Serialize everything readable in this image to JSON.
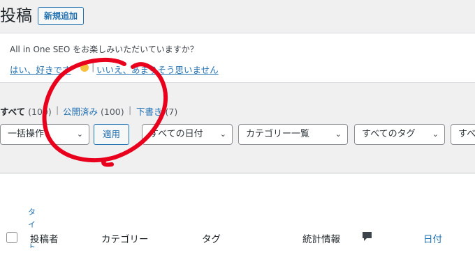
{
  "header": {
    "title": "投稿",
    "add_new": "新規追加"
  },
  "notice": {
    "text": "All in One SEO をお楽しみいただいていますか？",
    "yes": "はい、好きです",
    "no": "いいえ、あまりそう思いません"
  },
  "status_filter": [
    {
      "label": "すべて",
      "count": "(100)"
    },
    {
      "label": "公開済み",
      "count": "(100)"
    },
    {
      "label": "下書き",
      "count": "(7)"
    }
  ],
  "controls": {
    "bulk_action": "一括操作",
    "apply": "適用",
    "date_filter": "すべての日付",
    "category_filter": "カテゴリー一覧",
    "tag_filter": "すべてのタグ",
    "more_filter": "すべ"
  },
  "table": {
    "truncated_title": [
      "タ",
      "イ",
      "ト"
    ],
    "columns": [
      "投稿者",
      "カテゴリー",
      "タグ",
      "統計情報",
      "日付"
    ]
  },
  "annotation_color": "#e8001c"
}
